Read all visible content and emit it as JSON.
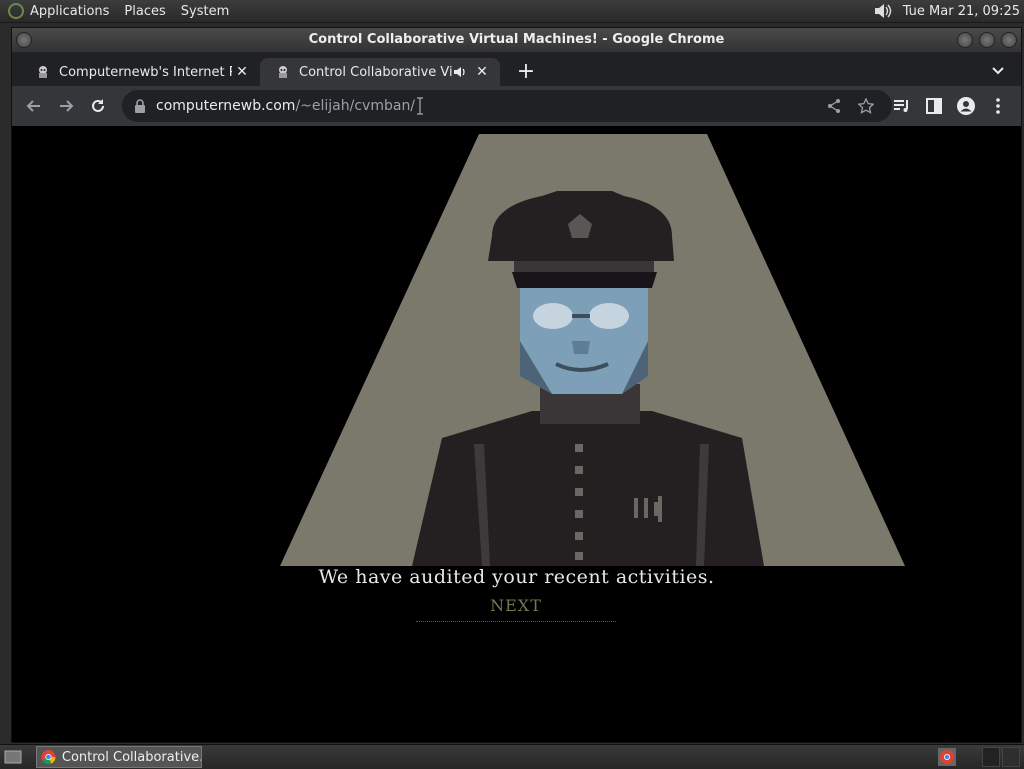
{
  "top_panel": {
    "menus": [
      "Applications",
      "Places",
      "System"
    ],
    "clock": "Tue Mar 21, 09:25",
    "icons": {
      "logo": "gnome-foot-icon",
      "volume": "speaker-icon"
    }
  },
  "window": {
    "title": "Control Collaborative Virtual Machines! - Google Chrome"
  },
  "tabs": [
    {
      "title": "Computernewb's Internet Pub",
      "active": false
    },
    {
      "title": "Control Collaborative Virtu",
      "active": true,
      "audio": true
    }
  ],
  "toolbar": {
    "url_host": "computernewb.com",
    "url_path": "/~elijah/cvmban/"
  },
  "game": {
    "caption": "We have audited your recent activities.",
    "next_label": "NEXT"
  },
  "bottom_panel": {
    "task_label": "Control Collaborative..."
  },
  "colors": {
    "spotlight": "#7b786c",
    "face": "#7e9fb8",
    "uniform": "#242022",
    "next": "#6f7a52"
  }
}
